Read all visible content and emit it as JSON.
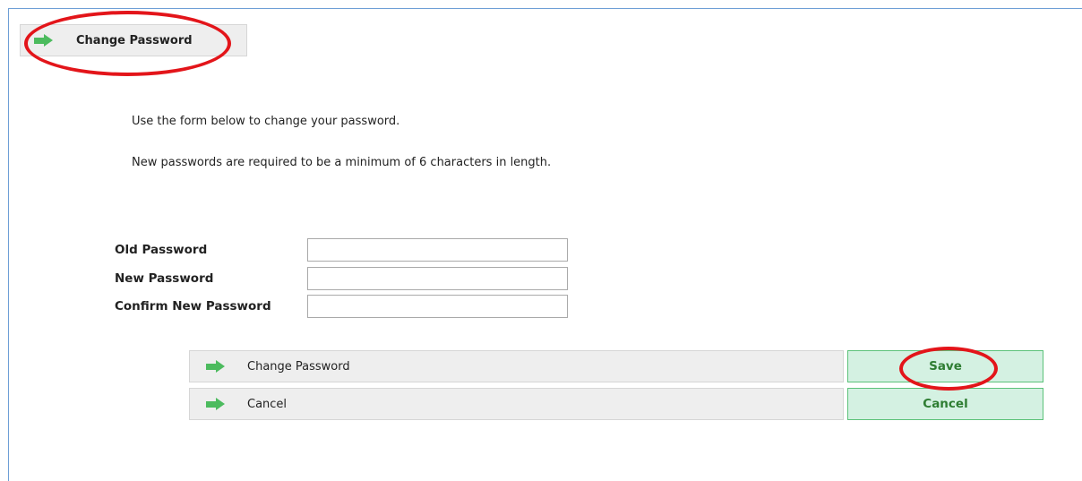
{
  "header": {
    "title": "Change Password",
    "icon": "arrow-right-icon"
  },
  "intro": {
    "line1": "Use the form below to change your password.",
    "line2": "New passwords are required to be a minimum of 6 characters in length."
  },
  "form": {
    "old_password": {
      "label": "Old Password",
      "value": ""
    },
    "new_password": {
      "label": "New Password",
      "value": ""
    },
    "confirm_password": {
      "label": "Confirm New Password",
      "value": ""
    }
  },
  "actions": [
    {
      "label": "Change Password",
      "button": "Save"
    },
    {
      "label": "Cancel",
      "button": "Cancel"
    }
  ],
  "colors": {
    "accent_green": "#4cbb5e",
    "button_bg": "#d4f1e2",
    "button_text": "#2e7d32",
    "annotation_red": "#e3151a",
    "frame_blue": "#6e9fd6"
  }
}
